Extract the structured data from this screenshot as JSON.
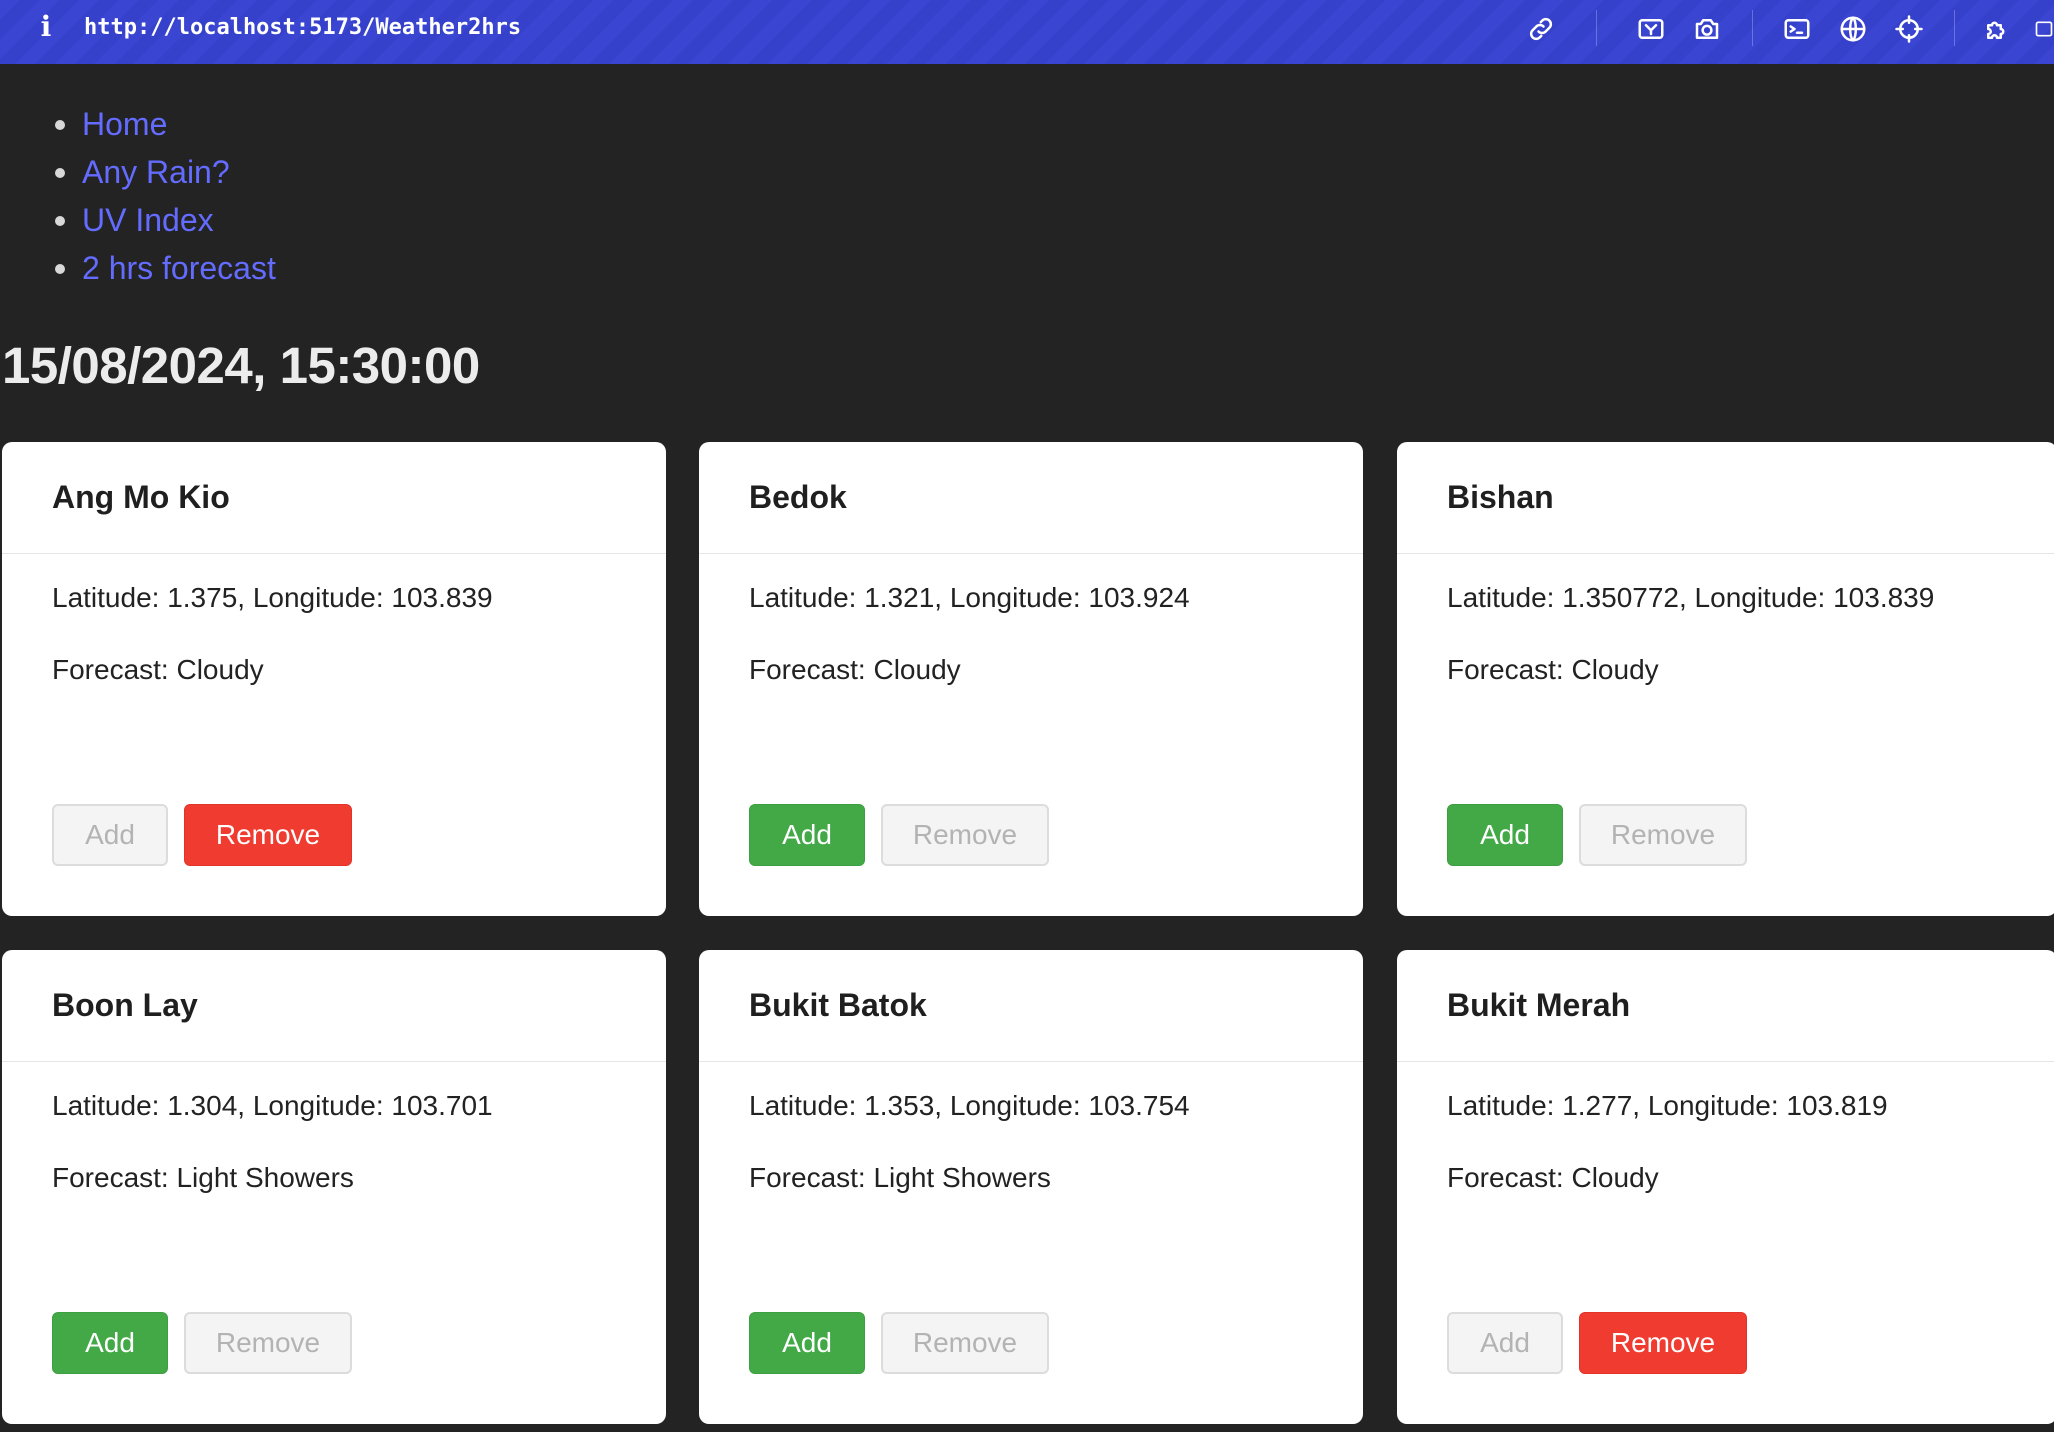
{
  "browser": {
    "info_glyph": "i",
    "url": "http://localhost:5173/Weather2hrs",
    "icons": [
      "link-icon",
      "screenshot-region-icon",
      "camera-icon",
      "terminal-icon",
      "globe-icon",
      "crosshair-icon",
      "puzzle-icon",
      "sidebar-icon"
    ],
    "accent_color": "#3a45d2"
  },
  "nav": {
    "items": [
      {
        "label": "Home"
      },
      {
        "label": "Any Rain?"
      },
      {
        "label": "UV Index"
      },
      {
        "label": "2 hrs forecast"
      }
    ],
    "link_color": "#646cff"
  },
  "timestamp": "15/08/2024, 15:30:00",
  "cards": [
    {
      "title": "Ang Mo Kio",
      "coords": "Latitude: 1.375, Longitude: 103.839",
      "forecast": "Forecast: Cloudy",
      "add_label": "Add",
      "remove_label": "Remove",
      "add_enabled": false,
      "remove_enabled": true
    },
    {
      "title": "Bedok",
      "coords": "Latitude: 1.321, Longitude: 103.924",
      "forecast": "Forecast: Cloudy",
      "add_label": "Add",
      "remove_label": "Remove",
      "add_enabled": true,
      "remove_enabled": false
    },
    {
      "title": "Bishan",
      "coords": "Latitude: 1.350772, Longitude: 103.839",
      "forecast": "Forecast: Cloudy",
      "add_label": "Add",
      "remove_label": "Remove",
      "add_enabled": true,
      "remove_enabled": false
    },
    {
      "title": "Boon Lay",
      "coords": "Latitude: 1.304, Longitude: 103.701",
      "forecast": "Forecast: Light Showers",
      "add_label": "Add",
      "remove_label": "Remove",
      "add_enabled": true,
      "remove_enabled": false
    },
    {
      "title": "Bukit Batok",
      "coords": "Latitude: 1.353, Longitude: 103.754",
      "forecast": "Forecast: Light Showers",
      "add_label": "Add",
      "remove_label": "Remove",
      "add_enabled": true,
      "remove_enabled": false
    },
    {
      "title": "Bukit Merah",
      "coords": "Latitude: 1.277, Longitude: 103.819",
      "forecast": "Forecast: Cloudy",
      "add_label": "Add",
      "remove_label": "Remove",
      "add_enabled": false,
      "remove_enabled": true
    }
  ],
  "colors": {
    "add_active": "#43a947",
    "remove_active": "#f03b30",
    "disabled_text": "#b3b3b3",
    "page_background": "#232323"
  }
}
